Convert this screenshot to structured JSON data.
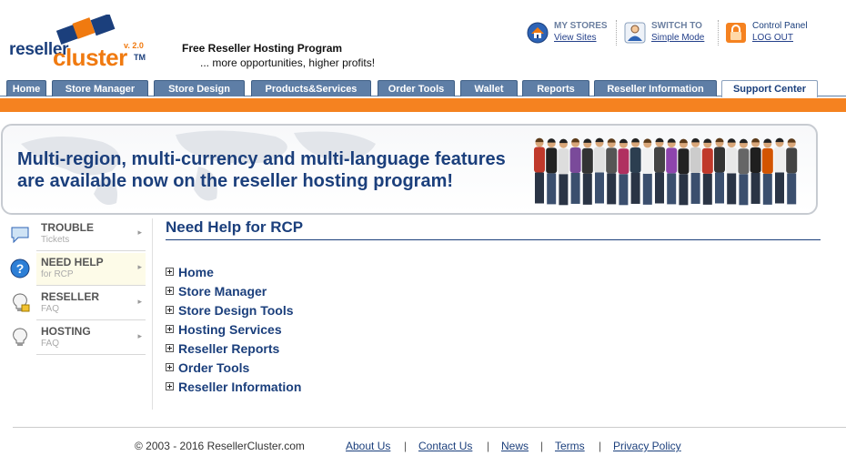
{
  "logo": {
    "word1": "reseller",
    "word2": "cluster",
    "version": "v. 2.0",
    "tm": "TM"
  },
  "slogan": {
    "title": "Free Reseller Hosting Program",
    "subtitle": "... more opportunities, higher profits!"
  },
  "quick_links": {
    "my_stores": {
      "label": "MY STORES",
      "link": "View Sites",
      "icon": "home-globe-icon"
    },
    "switch": {
      "label": "SWITCH TO",
      "link": "Simple Mode",
      "icon": "switch-mode-icon"
    },
    "control": {
      "label": "Control Panel",
      "link": "LOG OUT",
      "icon": "lock-icon"
    }
  },
  "tabs": [
    "Home",
    "Store Manager",
    "Store Design",
    "Products&Services",
    "Order Tools",
    "Wallet",
    "Reports",
    "Reseller Information",
    "Support Center"
  ],
  "active_tab": "Support Center",
  "banner": {
    "line1": "Multi-region, multi-currency and multi-language features",
    "line2": "are available now on the reseller hosting program!"
  },
  "sidebar": [
    {
      "title": "TROUBLE",
      "sub": "Tickets",
      "icon": "speech-bubble-icon",
      "active": false
    },
    {
      "title": "NEED HELP",
      "sub": "for RCP",
      "icon": "question-icon",
      "active": true
    },
    {
      "title": "RESELLER",
      "sub": "FAQ",
      "icon": "lightbulb-icon",
      "active": false
    },
    {
      "title": "HOSTING",
      "sub": "FAQ",
      "icon": "lightbulb-icon",
      "active": false
    }
  ],
  "main": {
    "title": "Need Help for RCP",
    "items": [
      "Home",
      "Store Manager",
      "Store Design Tools",
      "Hosting Services",
      "Reseller Reports",
      "Order Tools",
      "Reseller Information"
    ]
  },
  "footer": {
    "copyright": "© 2003 - 2016 ResellerCluster.com",
    "links": [
      "About Us",
      "Contact Us",
      "News",
      "Terms",
      "Privacy Policy"
    ],
    "separator": "|"
  },
  "colors": {
    "brand_blue": "#1b3f7c",
    "brand_orange": "#f58220",
    "tab_blue": "#5e7ea6"
  }
}
